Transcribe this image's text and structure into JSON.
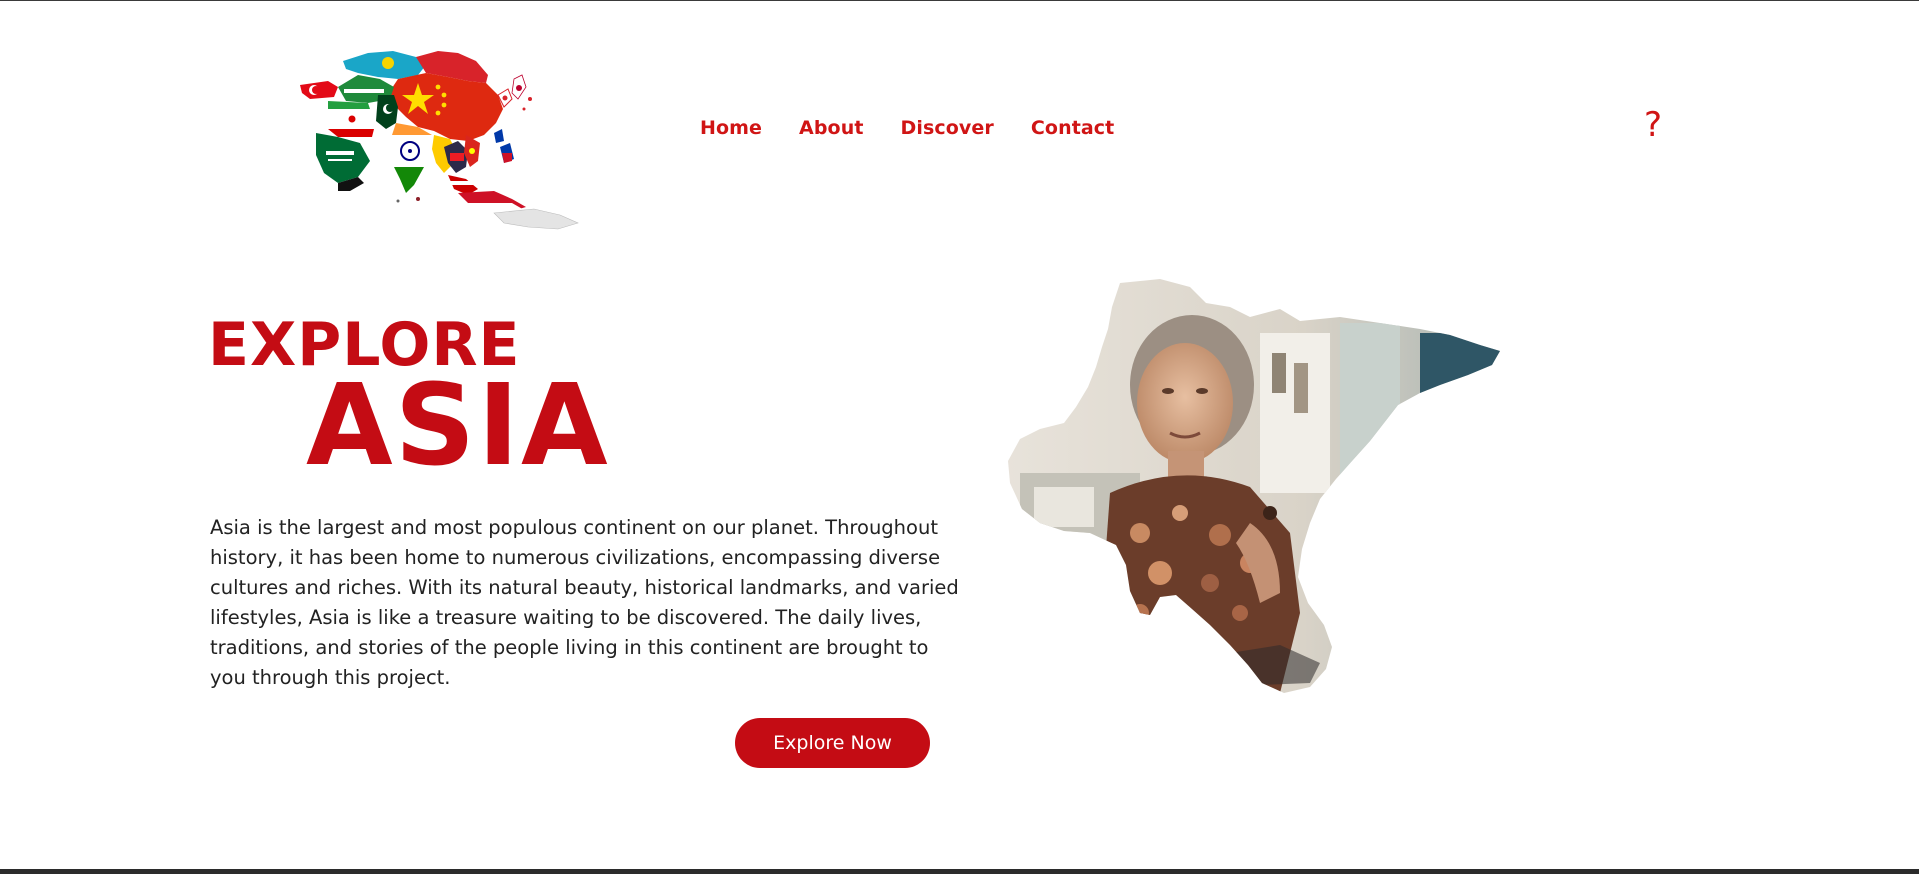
{
  "nav": {
    "items": [
      {
        "label": "Home"
      },
      {
        "label": "About"
      },
      {
        "label": "Discover"
      },
      {
        "label": "Contact"
      }
    ],
    "help_glyph": "?",
    "color": "#d01515"
  },
  "logo": {
    "icon": "asia-flags-map-logo"
  },
  "hero": {
    "title_line1": "EXPLORE",
    "title_line2": "ASIA",
    "paragraph": "Asia is the largest and most populous continent on our planet. Throughout history, it has been home to numerous civilizations, encompassing diverse cultures and riches. With its natural beauty, historical landmarks, and varied lifestyles, Asia is like a treasure waiting to be discovered. The daily lives, traditions, and stories of the people living in this continent are brought to you through this project.",
    "cta_label": "Explore Now",
    "image_icon": "asia-map-portrait-image",
    "accent_color": "#c40c14"
  }
}
